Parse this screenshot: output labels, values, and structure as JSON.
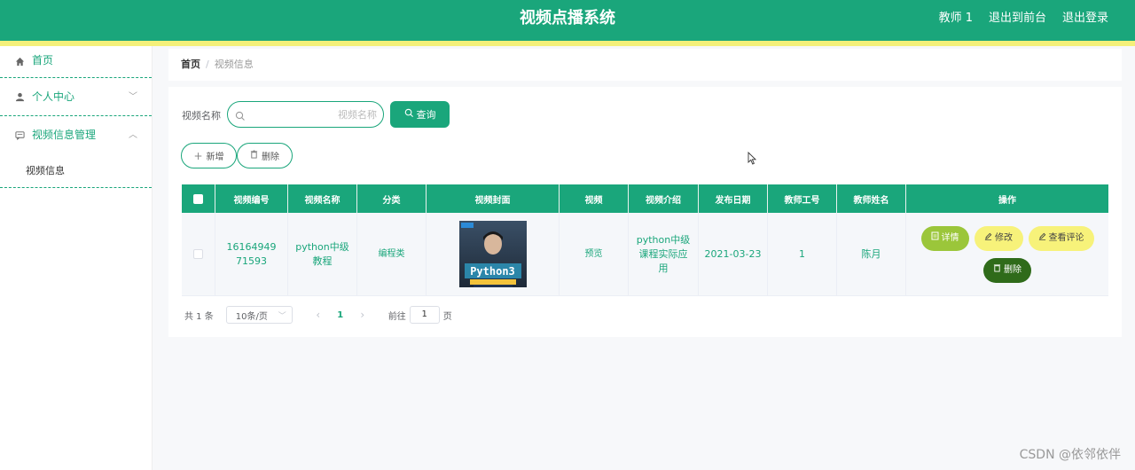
{
  "header": {
    "title": "视频点播系统",
    "user": "教师 1",
    "back_to_front": "退出到前台",
    "logout": "退出登录",
    "colors": {
      "primary": "#1aa67b",
      "stripe": "#f4f07a"
    }
  },
  "sidebar": {
    "items": [
      {
        "label": "首页",
        "icon": "home-icon"
      },
      {
        "label": "个人中心",
        "icon": "user-icon"
      },
      {
        "label": "视频信息管理",
        "icon": "message-icon"
      }
    ],
    "sub_items": [
      {
        "label": "视频信息"
      }
    ]
  },
  "breadcrumb": {
    "home": "首页",
    "separator": "/",
    "current": "视频信息"
  },
  "search": {
    "label": "视频名称",
    "placeholder": "视频名称",
    "query_button": "查询"
  },
  "toolbar": {
    "add": "新增",
    "delete": "删除"
  },
  "table": {
    "headers": [
      "视频编号",
      "视频名称",
      "分类",
      "视频封面",
      "视频",
      "视频介绍",
      "发布日期",
      "教师工号",
      "教师姓名",
      "操作"
    ],
    "rows": [
      {
        "video_id": "1616494971593",
        "name": "python中级教程",
        "category": "编程类",
        "cover_text": "Python3",
        "video": "预览",
        "intro": "python中级课程实际应用",
        "date": "2021-03-23",
        "teacher_no": "1",
        "teacher_name": "陈月",
        "actions": {
          "detail": "详情",
          "edit": "修改",
          "comment": "查看评论",
          "delete": "删除"
        }
      }
    ]
  },
  "pagination": {
    "total": "共 1 条",
    "page_size": "10条/页",
    "current_page": "1",
    "goto_label": "前往",
    "goto_value": "1",
    "page_suffix": "页"
  },
  "watermark": "CSDN @依邻依伴"
}
